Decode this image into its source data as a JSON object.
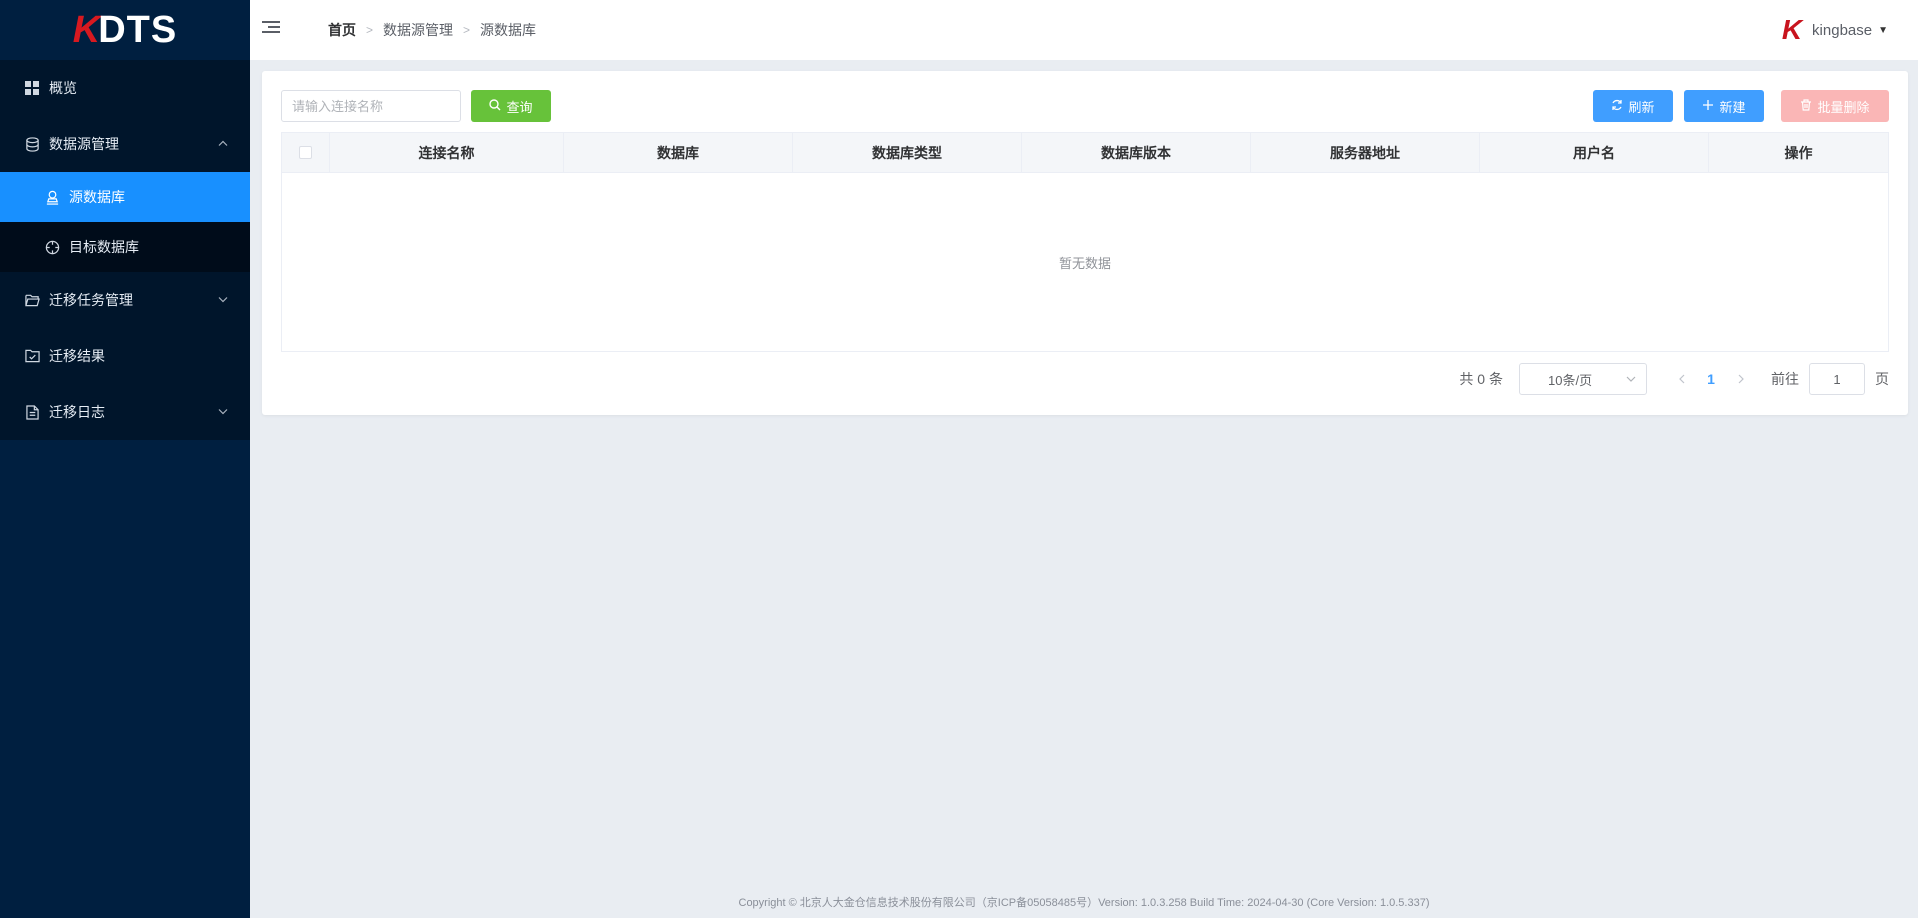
{
  "brand": {
    "logo_k": "K",
    "logo_rest": "DTS"
  },
  "sidebar": {
    "items": [
      {
        "label": "概览",
        "icon": "grid-icon"
      },
      {
        "label": "数据源管理",
        "icon": "database-icon",
        "expanded": true,
        "children": [
          {
            "label": "源数据库",
            "icon": "user-stamp-icon",
            "active": true
          },
          {
            "label": "目标数据库",
            "icon": "target-icon"
          }
        ]
      },
      {
        "label": "迁移任务管理",
        "icon": "folder-open-icon"
      },
      {
        "label": "迁移结果",
        "icon": "folder-check-icon"
      },
      {
        "label": "迁移日志",
        "icon": "document-icon"
      }
    ]
  },
  "header": {
    "breadcrumb": [
      "首页",
      "数据源管理",
      "源数据库"
    ],
    "user": "kingbase",
    "user_logo": "K"
  },
  "toolbar": {
    "search_placeholder": "请输入连接名称",
    "query_label": "查询",
    "refresh_label": "刷新",
    "new_label": "新建",
    "batch_delete_label": "批量删除"
  },
  "table": {
    "columns": [
      "连接名称",
      "数据库",
      "数据库类型",
      "数据库版本",
      "服务器地址",
      "用户名",
      "操作"
    ],
    "rows": [],
    "empty_text": "暂无数据"
  },
  "pagination": {
    "total_text": "共 0 条",
    "page_size": "10条/页",
    "current_page": "1",
    "goto_label": "前往",
    "goto_value": "1",
    "page_suffix": "页"
  },
  "footer": {
    "text": "Copyright © 北京人大金仓信息技术股份有限公司（京ICP备05058485号）Version: 1.0.3.258 Build Time: 2024-04-30 (Core Version: 1.0.5.337)"
  },
  "colors": {
    "sidebar_bg": "#001f40",
    "active": "#1890ff",
    "primary": "#409eff",
    "success": "#67c23a",
    "danger_disabled": "#fab6b6",
    "brand_red": "#d71920"
  }
}
